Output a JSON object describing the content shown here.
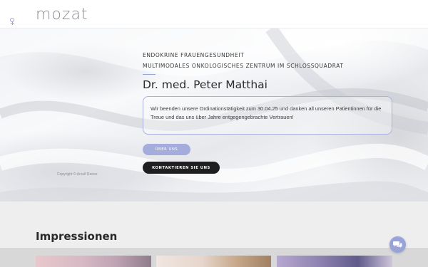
{
  "header": {
    "logo_text": "mozat"
  },
  "hero": {
    "eyebrow_line_1": "Endokrine Frauengesundheit",
    "eyebrow_line_2": "Multimodales Onkologisches Zentrum im Schlossquadrat",
    "title": "Dr. med. Peter Matthai",
    "notice": "Wir beenden unsere Ordinationstätigkeit zum 30.04.25 und danken all unseren Patientinnen für die Treue und das uns über Jahre entgegengebrachte Vertrauen!",
    "about_button_label": "Über uns",
    "contact_button_label": "Kontaktieren Sie uns",
    "copyright": "Copyright © Arnulf Rainer"
  },
  "impressions": {
    "title": "Impressionen"
  },
  "icons": {
    "chat": "chat-icon",
    "logo_symbol": "venus-icon"
  },
  "colors": {
    "accent": "#9aa3d8",
    "dark_button": "#1f1f21",
    "light_button": "#a4acdc"
  }
}
